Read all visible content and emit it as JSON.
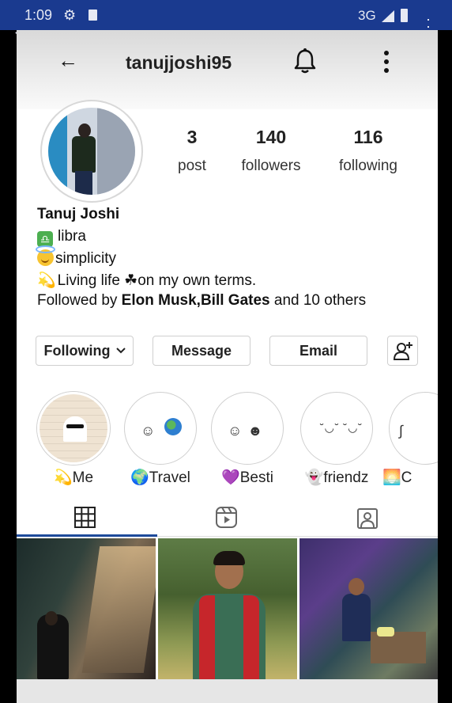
{
  "status_bar": {
    "time": "1:09",
    "network": "3G"
  },
  "header": {
    "username": "tanujjoshi95"
  },
  "stats": [
    {
      "value": "3",
      "label": "post"
    },
    {
      "value": "140",
      "label": "followers"
    },
    {
      "value": "116",
      "label": "following"
    }
  ],
  "bio": {
    "name": "Tanuj Joshi",
    "line1": "libra",
    "line2": "simplicity",
    "line3": "Living life ☘on my own terms.",
    "followed_prefix": "Followed by ",
    "followed_names": "Elon Musk,Bill Gates",
    "followed_suffix": " and 10 others"
  },
  "buttons": {
    "following": "Following",
    "message": "Message",
    "email": "Email"
  },
  "highlights": [
    {
      "emoji": "💫",
      "label": "Me"
    },
    {
      "emoji": "🌍",
      "label": "Travel"
    },
    {
      "emoji": "💜",
      "label": "Besti"
    },
    {
      "emoji": "👻",
      "label": "friendz"
    },
    {
      "emoji": "🌅",
      "label": "C"
    }
  ],
  "tabs": [
    "grid-icon",
    "reels-icon",
    "tagged-icon"
  ],
  "colors": {
    "status_bar": "#1a3a8f",
    "active_tab_underline": "#1e4a9a"
  }
}
